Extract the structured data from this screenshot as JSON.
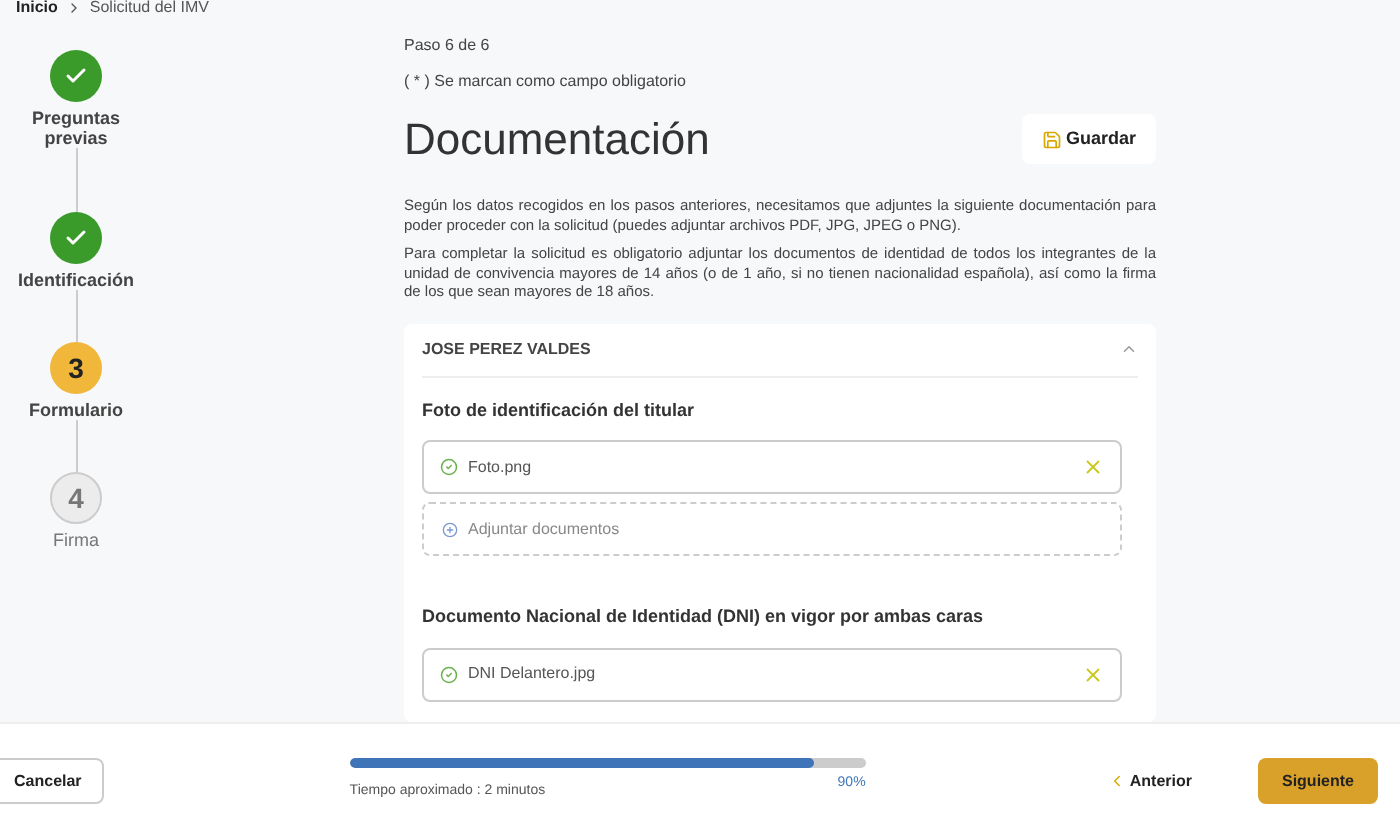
{
  "breadcrumb": {
    "items": [
      "Inicio",
      "Solicitud del IMV"
    ]
  },
  "steps": [
    {
      "label": "Preguntas previas",
      "kind": "done"
    },
    {
      "label": "Identificación",
      "kind": "done"
    },
    {
      "number": "3",
      "label": "Formulario",
      "kind": "current"
    },
    {
      "number": "4",
      "label": "Firma",
      "kind": "pending"
    }
  ],
  "step_counter": "Paso 6 de 6",
  "required_note": "( * ) Se marcan como campo obligatorio",
  "title": "Documentación",
  "save_button": "Guardar",
  "paragraphs": [
    "Según los datos recogidos en los pasos anteriores, necesitamos que adjuntes la siguiente documentación para poder proceder con la solicitud (puedes adjuntar archivos PDF, JPG, JPEG o PNG).",
    "Para completar la solicitud es obligatorio adjuntar los documentos de identidad de todos los integrantes de la unidad de convivencia mayores de 14 años (o de 1 año, si no tienen nacionalidad española), así como la firma de los que sean mayores de 18 años."
  ],
  "person": {
    "name": "JOSE PEREZ VALDES",
    "expanded": true,
    "sections": [
      {
        "title": "Foto de identificación del titular",
        "files": [
          "Foto.png"
        ],
        "attach": "Adjuntar documentos"
      },
      {
        "title": "Documento Nacional de Identidad (DNI) en vigor por ambas caras",
        "files": [
          "DNI Delantero.jpg"
        ]
      }
    ]
  },
  "footer": {
    "cancel": "Cancelar",
    "progress": {
      "level": 0.9,
      "reading": "90%"
    },
    "time": "Tiempo aproximado : 2 minutos",
    "previous": "Anterior",
    "next": "Siguiente"
  }
}
